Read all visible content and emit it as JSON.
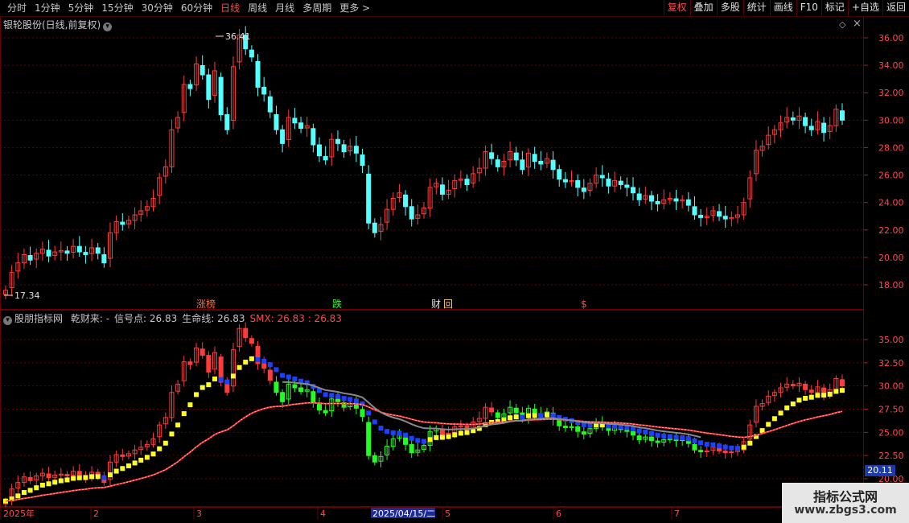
{
  "toolbar": {
    "periods": [
      "分时",
      "1分钟",
      "5分钟",
      "15分钟",
      "30分钟",
      "60分钟",
      "日线",
      "周线",
      "月线",
      "多周期",
      "更多 >"
    ],
    "active_period": "日线",
    "buttons": [
      "复权",
      "叠加",
      "多股",
      "统计",
      "画线",
      "F10",
      "标记",
      "+自选",
      "返回"
    ],
    "red_buttons": [
      "复权"
    ]
  },
  "stock": {
    "name": "银轮股份(日线,前复权)"
  },
  "main_chart": {
    "y_ticks": [
      "36.00",
      "34.00",
      "32.00",
      "30.00",
      "28.00",
      "26.00",
      "24.00",
      "22.00",
      "20.00",
      "18.00"
    ],
    "high_label": "36.41",
    "low_label": "17.34",
    "events": [
      "涨榜",
      "跌",
      "财",
      "回",
      "$"
    ]
  },
  "indicator": {
    "name": "股朋指标网",
    "legend": [
      {
        "label": "乾财来: -",
        "color": "#c8c8c8"
      },
      {
        "label": "信号点: 26.83",
        "color": "#c8c8c8"
      },
      {
        "label": "生命线: 26.83",
        "color": "#c8c8c8"
      },
      {
        "label": "SMX: 26.83 : 26.83",
        "color": "#ff4a4a"
      }
    ],
    "y_ticks": [
      "35.00",
      "32.50",
      "30.00",
      "27.50",
      "25.00",
      "22.50",
      "20.00"
    ],
    "price_tag": "20.11"
  },
  "x_axis": {
    "labels": [
      "2025年",
      "2",
      "3",
      "4",
      "5",
      "6",
      "7"
    ],
    "cursor_date": "2025/04/15/二"
  },
  "watermark": {
    "line1": "指标公式网",
    "line2": "www.zbgs3.com"
  },
  "colors": {
    "up": "#ff3b3b",
    "down": "#54ffff",
    "green": "#20ff20",
    "blue": "#2040ff",
    "yellow": "#ffff20",
    "grid": "#6a0000"
  },
  "chart_data": {
    "type": "candlestick",
    "x_range": [
      "2025-01-02",
      "2025-07-31"
    ],
    "y_range": [
      17.34,
      36.41
    ],
    "closes": [
      17.6,
      18.9,
      19.6,
      20.2,
      19.8,
      20.3,
      20.6,
      20.1,
      20.4,
      20.5,
      20.3,
      20.8,
      20.4,
      20.2,
      20.7,
      20.3,
      19.6,
      21.8,
      22.6,
      22.4,
      22.7,
      23.1,
      23.4,
      23.7,
      24.3,
      25.8,
      26.6,
      29.3,
      30.2,
      32.6,
      32.3,
      34.1,
      33.3,
      31.5,
      33.6,
      30.4,
      29.3,
      33.9,
      36.2,
      35.2,
      34.6,
      32.4,
      31.9,
      30.6,
      29.3,
      28.3,
      30.2,
      29.8,
      29.4,
      29.6,
      28.2,
      27.4,
      27.1,
      28.6,
      28.3,
      27.7,
      28.1,
      27.6,
      26.7,
      22.5,
      21.8,
      22.4,
      23.5,
      24.3,
      24.7,
      23.7,
      22.8,
      23.1,
      23.6,
      25.1,
      25.4,
      24.6,
      24.9,
      25.6,
      25.7,
      25.3,
      26.1,
      26.5,
      27.7,
      27.2,
      26.6,
      27.0,
      27.7,
      27.1,
      26.4,
      27.6,
      27.0,
      26.8,
      27.2,
      26.4,
      25.7,
      25.5,
      25.6,
      25.1,
      24.8,
      25.4,
      26.0,
      25.8,
      25.2,
      25.6,
      25.3,
      25.1,
      24.7,
      24.2,
      24.5,
      24.1,
      23.9,
      24.2,
      24.3,
      24.1,
      24.2,
      23.8,
      23.1,
      22.9,
      23.0,
      23.4,
      23.0,
      22.8,
      22.9,
      23.1,
      24.0,
      25.8,
      27.8,
      28.1,
      28.9,
      29.3,
      29.8,
      30.2,
      30.0,
      30.3,
      29.6,
      29.3,
      29.9,
      29.1,
      29.6,
      30.8,
      30.0
    ]
  }
}
